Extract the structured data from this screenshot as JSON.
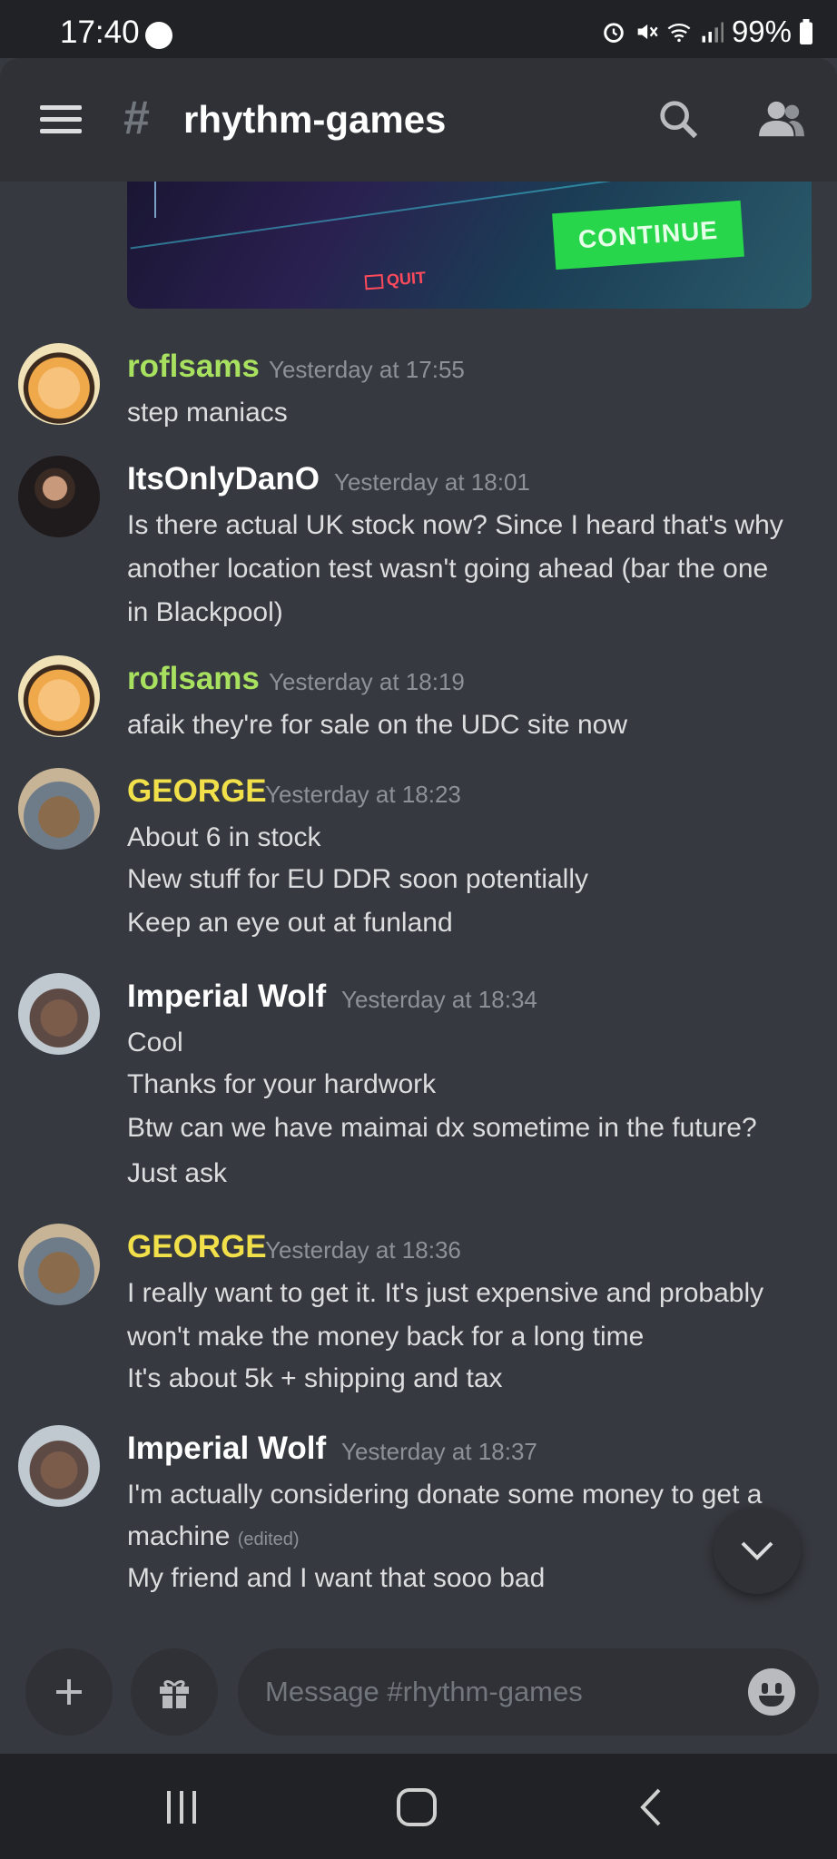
{
  "status_bar": {
    "time": "17:40",
    "battery": "99%",
    "icons": [
      "messenger-icon",
      "alarm-icon",
      "mute-icon",
      "wifi-icon",
      "signal-icon",
      "battery-icon"
    ]
  },
  "header": {
    "hash_symbol": "#",
    "channel_name": "rhythm-games",
    "icons": [
      "menu-icon",
      "search-icon",
      "members-icon"
    ]
  },
  "embed": {
    "continue_label": "CONTINUE",
    "quit_label": "QUIT"
  },
  "messages": [
    {
      "author": "roflsams",
      "color": "#a8e05f",
      "timestamp": "Yesterday at 17:55",
      "lines": [
        "step maniacs"
      ]
    },
    {
      "author": "ItsOnlyDanO",
      "color": "#ffffff",
      "timestamp": "Yesterday at 18:01",
      "lines": [
        "Is there actual UK stock now? Since I heard that's why",
        "another location test wasn't going ahead (bar the one",
        "in Blackpool)"
      ]
    },
    {
      "author": "roflsams",
      "color": "#a8e05f",
      "timestamp": "Yesterday at 18:19",
      "lines": [
        "afaik they're for sale on the UDC site now"
      ]
    },
    {
      "author": "GEORGE",
      "color": "#f1e04a",
      "timestamp": "Yesterday at 18:23",
      "lines": [
        "About 6 in stock",
        "New stuff for EU DDR soon potentially",
        "Keep an eye out at funland"
      ]
    },
    {
      "author": "Imperial Wolf",
      "color": "#ffffff",
      "timestamp": "Yesterday at 18:34",
      "lines": [
        "Cool",
        "Thanks for your hardwork",
        "Btw can we have maimai dx sometime in the future?",
        "Just ask"
      ]
    },
    {
      "author": "GEORGE",
      "color": "#f1e04a",
      "timestamp": "Yesterday at 18:36",
      "lines": [
        "I really want to get it. It's just expensive and probably",
        "won't make the money back for a long time",
        "It's about 5k + shipping and tax"
      ]
    },
    {
      "author": "Imperial Wolf",
      "color": "#ffffff",
      "timestamp": "Yesterday at 18:37",
      "lines": [
        "I'm actually considering donate some money to get a",
        "machine",
        "My friend and I want that sooo bad"
      ],
      "edited_label": "(edited)"
    }
  ],
  "composer": {
    "placeholder": "Message #rhythm-games",
    "icons": [
      "plus-icon",
      "gift-icon",
      "emoji-icon"
    ]
  },
  "nav": {
    "icons": [
      "recent-apps-icon",
      "home-icon",
      "back-icon"
    ]
  }
}
